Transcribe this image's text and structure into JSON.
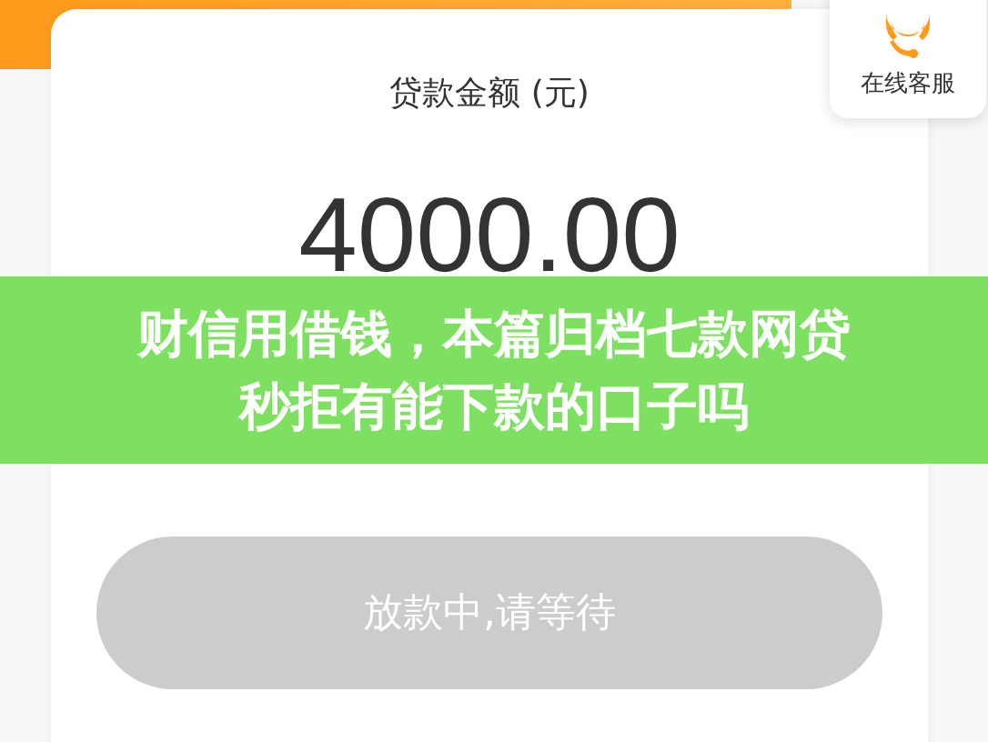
{
  "loan": {
    "label": "贷款金额 (元)",
    "amount": "4000.00"
  },
  "service": {
    "label": "在线客服"
  },
  "button": {
    "label": "放款中,请等待",
    "disabled": true
  },
  "banner": {
    "title": "财信用借钱，本篇归档七款网贷秒拒有能下款的口子吗"
  }
}
